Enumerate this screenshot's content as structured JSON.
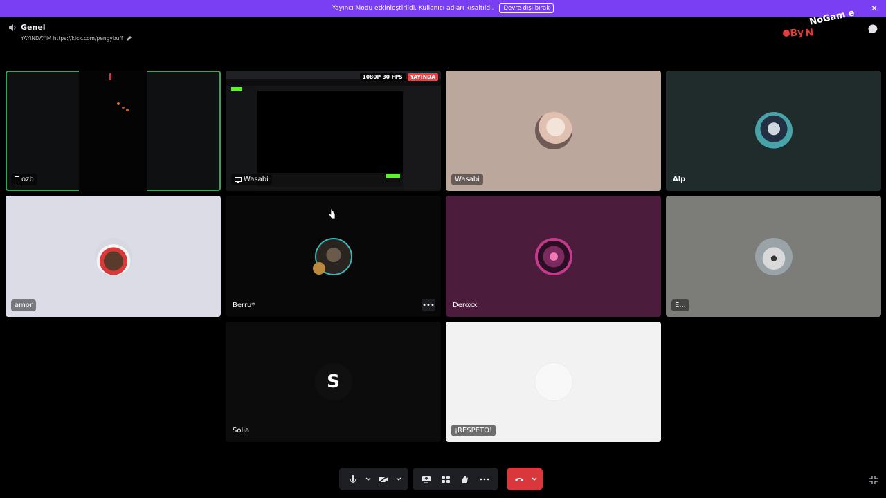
{
  "banner": {
    "text": "Yayıncı Modu etkinleştirildi. Kullanıcı adları kısaltıldı.",
    "button": "Devre dışı bırak"
  },
  "channel": {
    "name": "Genel",
    "status": "YAYINDAYIM https://kick.com/pengybuff"
  },
  "logo_text": "NoGame ByN",
  "participants": [
    {
      "name": "ozb",
      "bg": "#0f1012",
      "speaking": true
    },
    {
      "name": "Wasabi",
      "bg": "#0a0a0a",
      "stream_quality": "1080P 30 FPS",
      "live_badge": "YAYINDA"
    },
    {
      "name": "Wasabi",
      "bg": "#bca79d"
    },
    {
      "name": "Alp",
      "bg": "#202c2c"
    },
    {
      "name": "amor",
      "bg": "#dbdce6"
    },
    {
      "name": "Berru*",
      "bg": "#080808"
    },
    {
      "name": "Deroxx",
      "bg": "#4b1c3c"
    },
    {
      "name": "E...",
      "bg": "#7c7c79"
    },
    {
      "name": "Solia",
      "bg": "#0c0c0c",
      "initial": "S"
    },
    {
      "name": "¡RESPETO!",
      "bg": "#f2f2f2"
    }
  ],
  "colors": {
    "banner": "#7a3ff2",
    "speaking_ring": "#3ba55d",
    "hangup": "#da373c",
    "live": "#ed4245"
  },
  "icons": [
    "speaker-icon",
    "pencil-icon",
    "chat-icon",
    "microphone-icon",
    "camera-off-icon",
    "screen-share-icon",
    "activity-icon",
    "soundboard-icon",
    "more-icon",
    "hangup-icon",
    "fullscreen-icon"
  ]
}
